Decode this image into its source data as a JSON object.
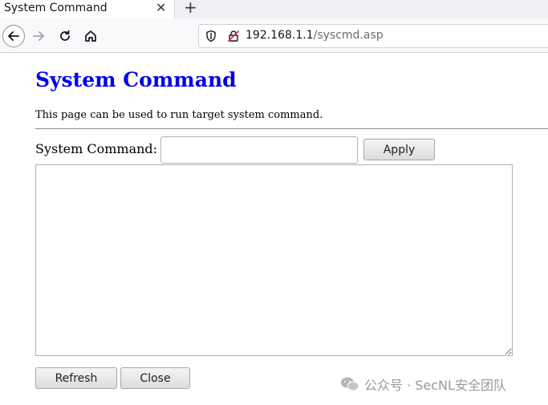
{
  "browser": {
    "tab_title": "System Command",
    "tab_close": "✕",
    "new_tab": "+",
    "url_host": "192.168.1.1",
    "url_path": "/syscmd.asp"
  },
  "page": {
    "title": "System Command",
    "description": "This page can be used to run target system command.",
    "command_label": "System Command:",
    "command_value": "",
    "apply_label": "Apply",
    "output_value": "",
    "refresh_label": "Refresh",
    "close_label": "Close"
  },
  "watermark": {
    "text": "公众号 · SecNL安全团队"
  },
  "colors": {
    "title_link_blue": "#0000ee",
    "tab_bg": "#f0f0f4",
    "toolbar_bg": "#f9f9fb"
  }
}
